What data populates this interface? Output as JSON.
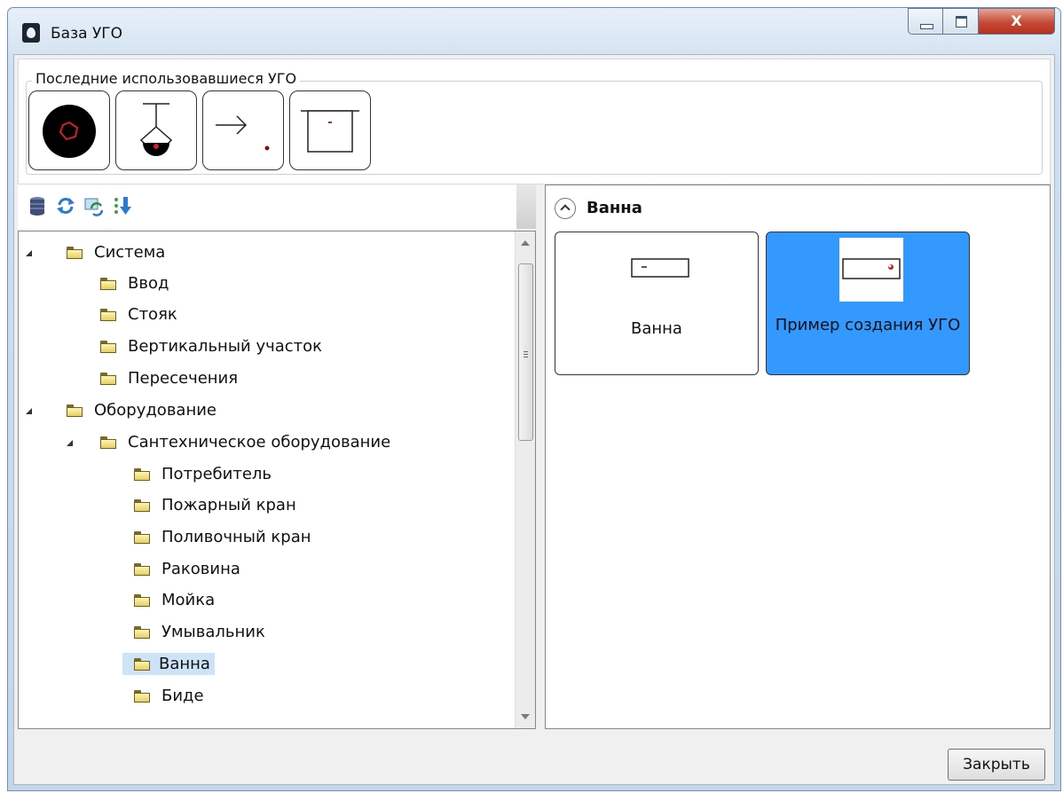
{
  "window": {
    "title": "База УГО",
    "controls": {
      "close_glyph": "X"
    }
  },
  "recent": {
    "legend": "Последние использовавшиеся УГО",
    "icons": [
      "round-symbol-icon",
      "pendant-fixture-icon",
      "arrow-point-icon",
      "bath-box-icon"
    ]
  },
  "toolbar": {
    "icons": [
      "database-icon",
      "refresh-icon",
      "sync-icon",
      "sort-icon"
    ]
  },
  "tree": {
    "items": [
      {
        "label": "Система",
        "level": 0,
        "expanded": true
      },
      {
        "label": "Ввод",
        "level": 1
      },
      {
        "label": "Стояк",
        "level": 1
      },
      {
        "label": "Вертикальный участок",
        "level": 1
      },
      {
        "label": "Пересечения",
        "level": 1
      },
      {
        "label": "Оборудование",
        "level": 0,
        "expanded": true
      },
      {
        "label": "Сантехническое оборудование",
        "level": 1,
        "expanded": true
      },
      {
        "label": "Потребитель",
        "level": 2
      },
      {
        "label": "Пожарный кран",
        "level": 2
      },
      {
        "label": "Поливочный кран",
        "level": 2
      },
      {
        "label": "Раковина",
        "level": 2
      },
      {
        "label": "Мойка",
        "level": 2
      },
      {
        "label": "Умывальник",
        "level": 2
      },
      {
        "label": "Ванна",
        "level": 2,
        "selected": true
      },
      {
        "label": "Биде",
        "level": 2
      }
    ]
  },
  "panel": {
    "section_title": "Ванна",
    "cards": [
      {
        "label": "Ванна",
        "selected": false
      },
      {
        "label": "Пример создания УГО",
        "selected": true
      }
    ]
  },
  "footer": {
    "close_label": "Закрыть"
  },
  "colors": {
    "selection": "#3399ff",
    "tree_selection": "#cde3f7",
    "close_button": "#c54a36"
  }
}
